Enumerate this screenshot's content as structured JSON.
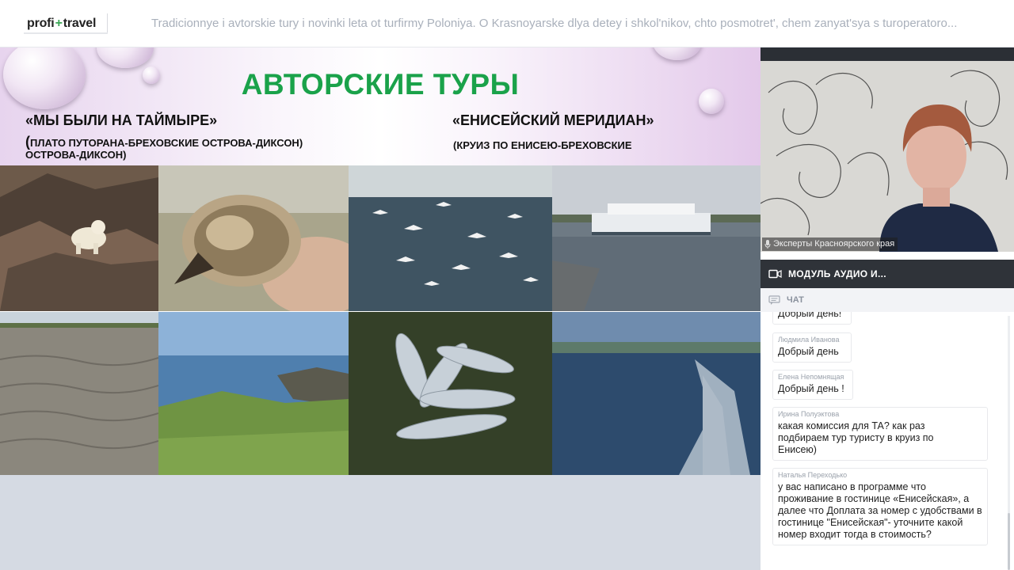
{
  "header": {
    "logo_left": "profi",
    "logo_plus": "+",
    "logo_right": "travel",
    "title": "Tradicionnye i avtorskie tury i novinki leta ot turfirmy Poloniya. O Krasnoyarske dlya detey i shkol'nikov, chto posmotret', chem zanyat'sya s turoperatoro..."
  },
  "slide": {
    "heading": "АВТОРСКИЕ ТУРЫ",
    "left_title": "«МЫ БЫЛИ НА ТАЙМЫРЕ»",
    "left_desc_open": "(",
    "left_desc_line1": "ПЛАТО ПУТОРАНА-БРЕХОВСКИЕ ОСТРОВА-ДИКСОН)",
    "left_desc_line2": "ОСТРОВА-ДИКСОН)",
    "right_title": "«ЕНИСЕЙСКИЙ МЕРИДИАН»",
    "right_desc": "(КРУИЗ ПО ЕНИСЕЮ-БРЕХОВСКИЕ"
  },
  "video": {
    "speaker_label": "Эксперты Красноярского края"
  },
  "module": {
    "label": "МОДУЛЬ АУДИО И..."
  },
  "chat": {
    "tab_label": "ЧАТ",
    "messages": [
      {
        "author": "",
        "text": "Добрый день!"
      },
      {
        "author": "Людмила Иванова",
        "text": "Добрый день"
      },
      {
        "author": "Елена Непомнящая",
        "text": "Добрый день !"
      },
      {
        "author": "Ирина Полуэктова",
        "text": "какая комиссия для ТА? как раз подбираем тур туристу в круиз по Енисею)"
      },
      {
        "author": "Наталья Переходько",
        "text": "у вас написано в программе что проживание в гостинице «Енисейская», а далее что Доплата за номер с удобствами в гостинице \"Енисейская\"- уточните какой номер входит тогда в стоимость?"
      }
    ]
  },
  "colors": {
    "heading_green": "#1aa24a",
    "logo_plus_green": "#3aa655",
    "module_bar": "#2f3339",
    "stage_bg": "#d5dae3"
  }
}
